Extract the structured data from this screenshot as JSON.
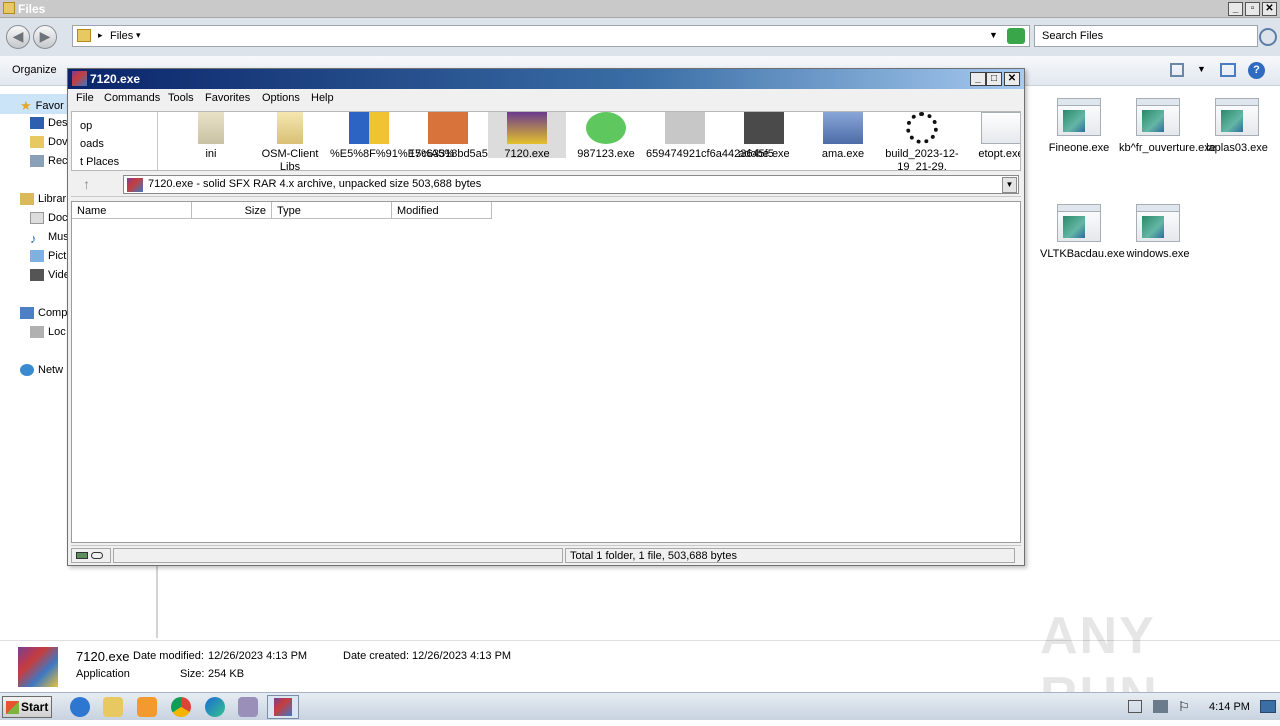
{
  "explorer": {
    "title": "Files",
    "address": "Files",
    "search_placeholder": "Search Files",
    "organize_label": "Organize",
    "nav": {
      "favorites": "Favor",
      "desktop": "Des",
      "downloads": "Dov",
      "recent": "Rec",
      "libraries": "Librar",
      "documents": "Doc",
      "music": "Mus",
      "pictures": "Pict",
      "videos": "Vide",
      "computer": "Comp",
      "local": "Loc",
      "network": "Netw"
    },
    "files_right": [
      {
        "name": "Fineone.exe"
      },
      {
        "name": "kb^fr_ouverture.exe"
      },
      {
        "name": "laplas03.exe"
      },
      {
        "name": "VLTKBacdau.exe"
      },
      {
        "name": "windows.exe"
      }
    ],
    "details": {
      "name": "7120.exe",
      "date_modified_label": "Date modified:",
      "date_modified": "12/26/2023 4:13 PM",
      "date_created_label": "Date created:",
      "date_created": "12/26/2023 4:13 PM",
      "type": "Application",
      "size_label": "Size:",
      "size": "254 KB"
    }
  },
  "winrar": {
    "title": "7120.exe",
    "menu": [
      "File",
      "Commands",
      "Tools",
      "Favorites",
      "Options",
      "Help"
    ],
    "left_pane": [
      "op",
      "oads",
      "t Places"
    ],
    "icons": [
      {
        "name": "ini"
      },
      {
        "name": "OSM-Client Libs"
      },
      {
        "name": "%E5%8F%91%E7%A5%"
      },
      {
        "name": "15c63318bd5a529e599e"
      },
      {
        "name": "7120.exe"
      },
      {
        "name": "987123.exe"
      },
      {
        "name": "659474921cf6a4423645f5"
      },
      {
        "name": "adobe.exe"
      },
      {
        "name": "ama.exe"
      },
      {
        "name": "build_2023-12-19_21-29."
      },
      {
        "name": "etopt.exe"
      }
    ],
    "path": "7120.exe - solid SFX RAR 4.x archive, unpacked size 503,688 bytes",
    "columns": [
      "Name",
      "Size",
      "Type",
      "Modified"
    ],
    "status": "Total 1 folder, 1 file, 503,688 bytes"
  },
  "taskbar": {
    "start": "Start",
    "time": "4:14 PM"
  },
  "watermark": "ANY RUN"
}
